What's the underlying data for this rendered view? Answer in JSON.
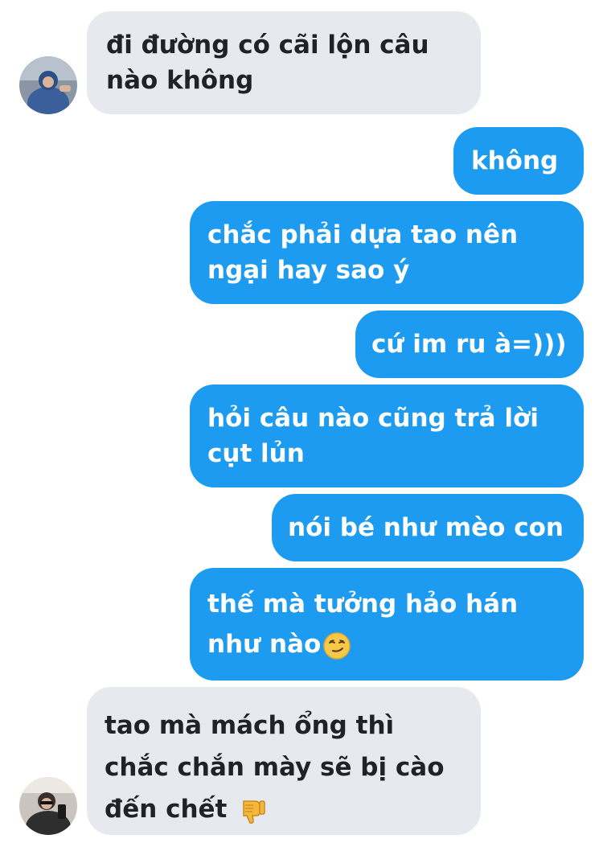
{
  "conversation": {
    "messages": [
      {
        "direction": "incoming",
        "lines": [
          "đi đường có cãi lộn câu",
          "nào không"
        ]
      },
      {
        "direction": "outgoing",
        "lines": [
          "không"
        ]
      },
      {
        "direction": "outgoing",
        "lines": [
          "chắc phải dựa tao nên",
          "ngại hay sao ý"
        ]
      },
      {
        "direction": "outgoing",
        "lines": [
          "cứ im ru à=)))"
        ]
      },
      {
        "direction": "outgoing",
        "lines": [
          "hỏi câu nào cũng trả lời",
          "cụt lủn"
        ]
      },
      {
        "direction": "outgoing",
        "lines": [
          "nói bé như mèo con"
        ]
      },
      {
        "direction": "outgoing",
        "lines": [
          "thế mà tưởng hảo hán",
          "như nào"
        ],
        "emoji": "smirking-face"
      },
      {
        "direction": "incoming",
        "lines": [
          "tao mà mách ổng thì",
          "chắc chắn mày sẽ bị cào",
          "đến chết"
        ],
        "emoji": "thumbs-down"
      }
    ]
  },
  "theme": {
    "incoming_bubble_color": "#e6e9ee",
    "outgoing_bubble_color": "#1d9bf0",
    "incoming_text_color": "#1f2329",
    "outgoing_text_color": "#ffffff"
  },
  "icons": [
    "avatar-photo",
    "smirking-face-emoji",
    "thumbs-down-emoji"
  ]
}
